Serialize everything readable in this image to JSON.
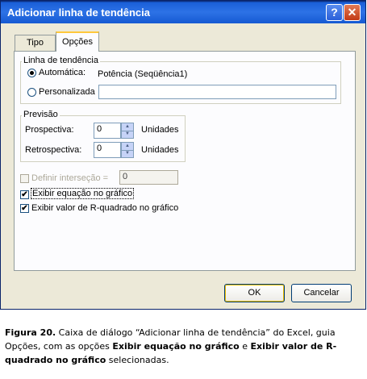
{
  "window": {
    "title": "Adicionar linha de tendência",
    "help_glyph": "?",
    "close_glyph": "✕"
  },
  "tabs": [
    {
      "label": "Tipo",
      "selected": false
    },
    {
      "label": "Opções",
      "selected": true
    }
  ],
  "trendline": {
    "group_label": "Linha de tendência",
    "auto_label": "Automática:",
    "auto_selected": true,
    "auto_value": "Potência (Seqüência1)",
    "custom_label": "Personalizada",
    "custom_value": ""
  },
  "forecast": {
    "group_label": "Previsão",
    "forward_label": "Prospectiva:",
    "forward_value": "0",
    "backward_label": "Retrospectiva:",
    "backward_value": "0",
    "unit_label": "Unidades"
  },
  "options": {
    "intercept_label": "Definir interseção =",
    "intercept_checked": false,
    "intercept_enabled": false,
    "intercept_value": "0",
    "show_equation_label": "Exibir equação no gráfico",
    "show_equation_checked": true,
    "show_r2_label": "Exibir valor de R-quadrado no gráfico",
    "show_r2_checked": true
  },
  "buttons": {
    "ok": "OK",
    "cancel": "Cancelar"
  },
  "caption": {
    "fig": "Figura 20.",
    "t1": " Caixa de diálogo “Adicionar linha de tendência” do Excel, guia Opções, com as opções ",
    "b1": "Exibir equação no gráfico",
    "t2": " e ",
    "b2": "Exibir valor de R-quadrado no gráfico",
    "t3": " selecionadas."
  }
}
